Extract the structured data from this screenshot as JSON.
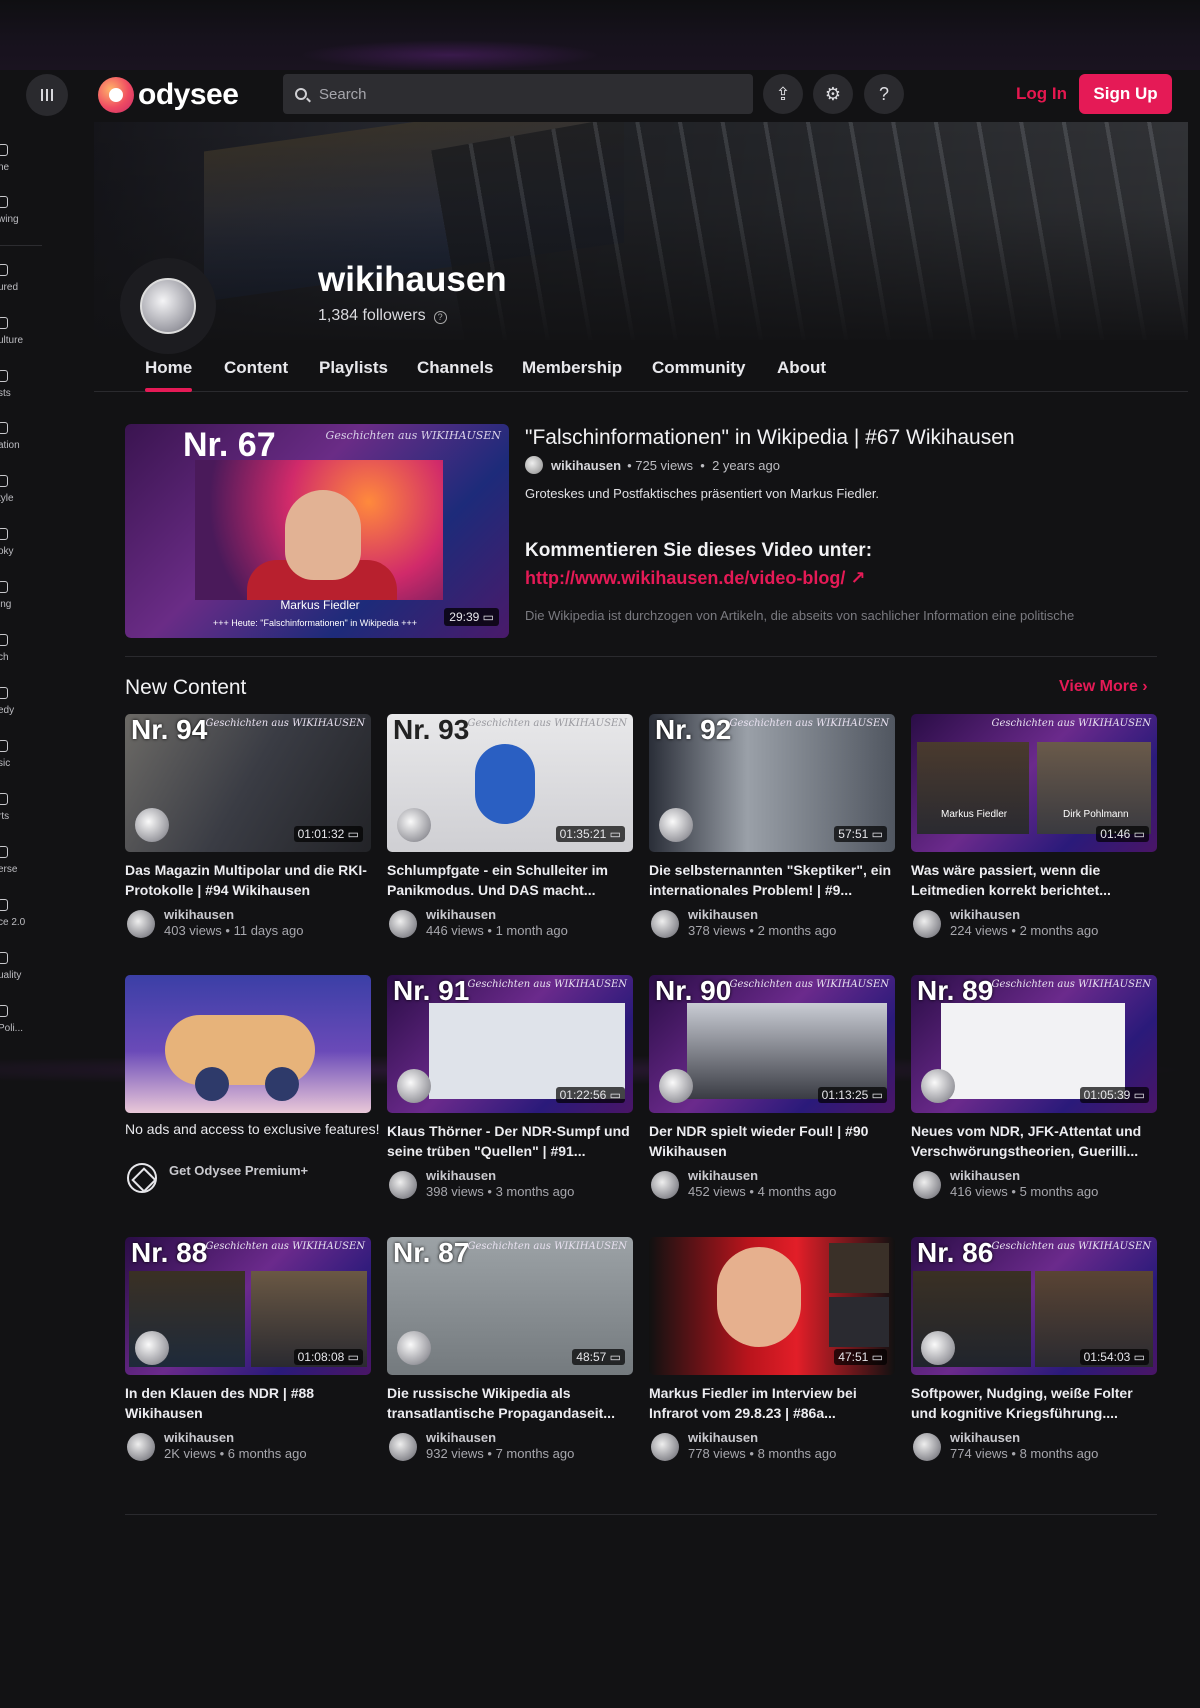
{
  "app": {
    "name": "odysee"
  },
  "header": {
    "search_placeholder": "Search",
    "login_label": "Log In",
    "signup_label": "Sign Up"
  },
  "sidebar": {
    "items": [
      {
        "label": "ne"
      },
      {
        "label": "wing"
      },
      {
        "label": "ured"
      },
      {
        "label": "ulture"
      },
      {
        "label": "sts"
      },
      {
        "label": "ation"
      },
      {
        "label": "tyle"
      },
      {
        "label": "oky"
      },
      {
        "label": "ing"
      },
      {
        "label": "ch"
      },
      {
        "label": "edy"
      },
      {
        "label": "sic"
      },
      {
        "label": "rts"
      },
      {
        "label": "erse"
      },
      {
        "label": "ce 2.0"
      },
      {
        "label": "uality"
      },
      {
        "label": "Poli..."
      }
    ]
  },
  "channel": {
    "name": "wikihausen",
    "followers": "1,384 followers"
  },
  "tabs": [
    {
      "label": "Home"
    },
    {
      "label": "Content"
    },
    {
      "label": "Playlists"
    },
    {
      "label": "Channels"
    },
    {
      "label": "Membership"
    },
    {
      "label": "Community"
    },
    {
      "label": "About"
    }
  ],
  "featured": {
    "thumb_number": "Nr. 67",
    "thumb_brand": "Geschichten aus WIKIHAUSEN",
    "thumb_name": "Markus Fiedler",
    "thumb_sub": "+++ Heute: \"Falschinformationen\" in Wikipedia +++",
    "duration": "29:39",
    "title": "\"Falschinformationen\" in Wikipedia | #67 Wikihausen",
    "author": "wikihausen",
    "views": "725 views",
    "age": "2 years ago",
    "description": "Groteskes und Postfaktisches präsentiert von Markus Fiedler.",
    "heading": "Kommentieren Sie dieses Video unter:",
    "link": "http://www.wikihausen.de/video-blog/",
    "more_text": "Die Wikipedia ist durchzogen von Artikeln, die abseits von sachlicher Information eine politische"
  },
  "new_content": {
    "title": "New Content",
    "view_more": "View More",
    "cards": [
      {
        "nr": "Nr. 94",
        "duration": "01:01:32",
        "title": "Das Magazin Multipolar und die RKI-Protokolle | #94 Wikihausen",
        "author": "wikihausen",
        "meta": "403 views • 11 days ago"
      },
      {
        "nr": "Nr. 93",
        "duration": "01:35:21",
        "title": "Schlumpfgate - ein Schulleiter im Panikmodus. Und DAS macht...",
        "author": "wikihausen",
        "meta": "446 views • 1 month ago"
      },
      {
        "nr": "Nr. 92",
        "duration": "57:51",
        "title": "Die selbsternannten \"Skeptiker\", ein internationales Problem! | #9...",
        "author": "wikihausen",
        "meta": "378 views • 2 months ago"
      },
      {
        "nr": "",
        "duration": "01:46",
        "title": "Was wäre passiert, wenn die Leitmedien korrekt berichtet...",
        "author": "wikihausen",
        "meta": "224 views • 2 months ago",
        "names": [
          "Markus Fiedler",
          "Dirk Pohlmann"
        ]
      },
      {
        "promo": true,
        "text": "No ads and access to exclusive features!",
        "link": "Get Odysee Premium+"
      },
      {
        "nr": "Nr. 91",
        "duration": "01:22:56",
        "title": "Klaus Thörner - Der NDR-Sumpf und seine trüben \"Quellen\" | #91...",
        "author": "wikihausen",
        "meta": "398 views • 3 months ago"
      },
      {
        "nr": "Nr. 90",
        "duration": "01:13:25",
        "title": "Der NDR spielt wieder Foul! | #90 Wikihausen",
        "author": "wikihausen",
        "meta": "452 views • 4 months ago"
      },
      {
        "nr": "Nr. 89",
        "duration": "01:05:39",
        "title": "Neues vom NDR, JFK-Attentat und Verschwörungstheorien, Guerilli...",
        "author": "wikihausen",
        "meta": "416 views • 5 months ago"
      },
      {
        "nr": "Nr. 88",
        "duration": "01:08:08",
        "title": "In den Klauen des NDR | #88 Wikihausen",
        "author": "wikihausen",
        "meta": "2K views • 6 months ago"
      },
      {
        "nr": "Nr. 87",
        "duration": "48:57",
        "title": "Die russische Wikipedia als transatlantische Propagandaseit...",
        "author": "wikihausen",
        "meta": "932 views • 7 months ago"
      },
      {
        "nr": "",
        "duration": "47:51",
        "title": "Markus Fiedler im Interview bei Infrarot vom 29.8.23 | #86a...",
        "author": "wikihausen",
        "meta": "778 views • 8 months ago"
      },
      {
        "nr": "Nr. 86",
        "duration": "01:54:03",
        "title": "Softpower, Nudging, weiße Folter und kognitive Kriegsführung....",
        "author": "wikihausen",
        "meta": "774 views • 8 months ago"
      }
    ]
  },
  "colors": {
    "accent": "#e51a56",
    "background": "#121214"
  }
}
